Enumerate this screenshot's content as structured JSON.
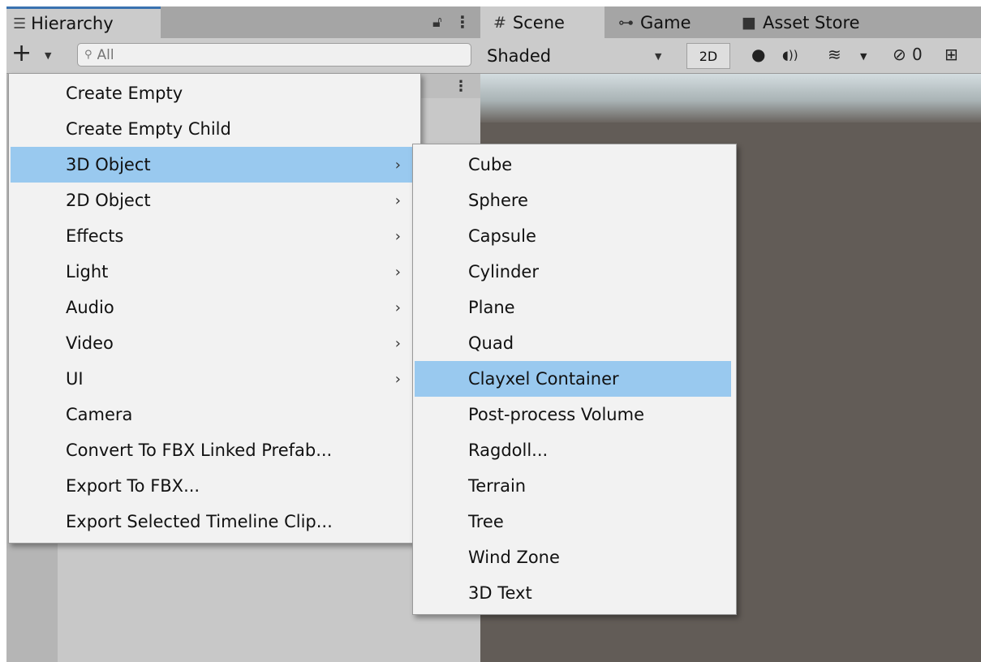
{
  "hierarchy": {
    "tab_label": "Hierarchy",
    "tab_icon": "list-icon",
    "search_placeholder": "All",
    "add_glyph": "+"
  },
  "scene": {
    "tabs": [
      {
        "label": "Scene",
        "icon": "grid-icon"
      },
      {
        "label": "Game",
        "icon": "gamepad-icon"
      },
      {
        "label": "Asset Store",
        "icon": "shopping-bag-icon"
      }
    ],
    "shading_mode": "Shaded",
    "mode_2d_label": "2D",
    "hidden_count": "0"
  },
  "menu_main": {
    "items": [
      {
        "label": "Create Empty",
        "submenu": false,
        "highlighted": false
      },
      {
        "label": "Create Empty Child",
        "submenu": false,
        "highlighted": false
      },
      {
        "label": "3D Object",
        "submenu": true,
        "highlighted": true
      },
      {
        "label": "2D Object",
        "submenu": true,
        "highlighted": false
      },
      {
        "label": "Effects",
        "submenu": true,
        "highlighted": false
      },
      {
        "label": "Light",
        "submenu": true,
        "highlighted": false
      },
      {
        "label": "Audio",
        "submenu": true,
        "highlighted": false
      },
      {
        "label": "Video",
        "submenu": true,
        "highlighted": false
      },
      {
        "label": "UI",
        "submenu": true,
        "highlighted": false
      },
      {
        "label": "Camera",
        "submenu": false,
        "highlighted": false
      },
      {
        "label": "Convert To FBX Linked Prefab...",
        "submenu": false,
        "highlighted": false
      },
      {
        "label": "Export To FBX...",
        "submenu": false,
        "highlighted": false
      },
      {
        "label": "Export Selected Timeline Clip...",
        "submenu": false,
        "highlighted": false
      }
    ]
  },
  "menu_sub": {
    "items": [
      {
        "label": "Cube",
        "highlighted": false
      },
      {
        "label": "Sphere",
        "highlighted": false
      },
      {
        "label": "Capsule",
        "highlighted": false
      },
      {
        "label": "Cylinder",
        "highlighted": false
      },
      {
        "label": "Plane",
        "highlighted": false
      },
      {
        "label": "Quad",
        "highlighted": false
      },
      {
        "label": "Clayxel Container",
        "highlighted": true
      },
      {
        "label": "Post-process Volume",
        "highlighted": false
      },
      {
        "label": "Ragdoll...",
        "highlighted": false
      },
      {
        "label": "Terrain",
        "highlighted": false
      },
      {
        "label": "Tree",
        "highlighted": false
      },
      {
        "label": "Wind Zone",
        "highlighted": false
      },
      {
        "label": "3D Text",
        "highlighted": false
      }
    ]
  },
  "colors": {
    "highlight": "#99c9ef",
    "menu_bg": "#f2f2f2",
    "active_tab_accent": "#3a72b0",
    "scene_bg": "#625c57"
  }
}
